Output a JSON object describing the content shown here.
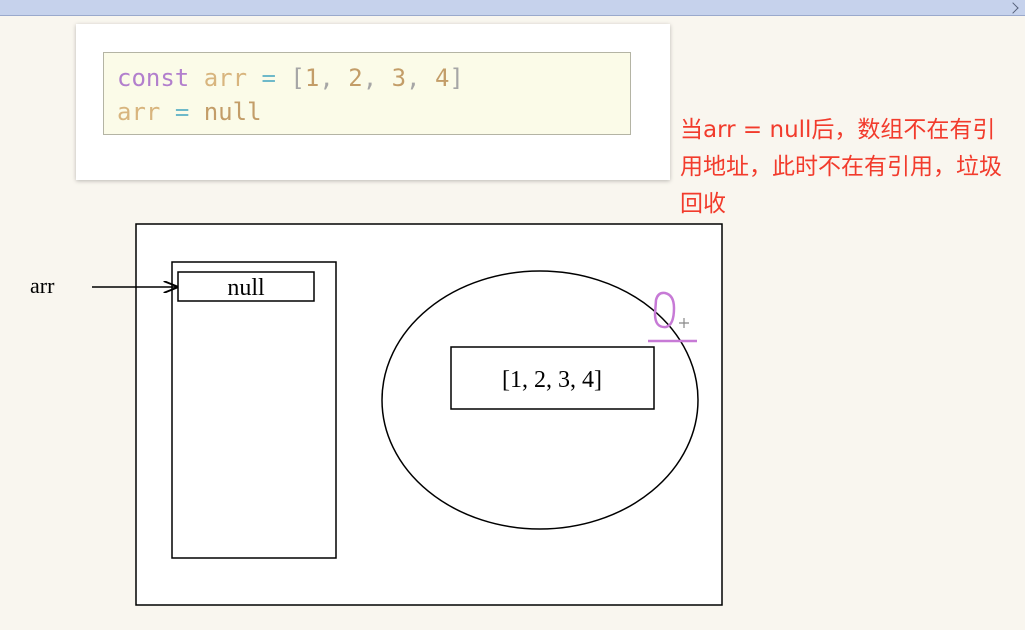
{
  "code": {
    "line1": {
      "keyword": "const",
      "name": "arr",
      "op": "=",
      "open": "[",
      "n1": "1",
      "c1": ",",
      "n2": "2",
      "c2": ",",
      "n3": "3",
      "c3": ",",
      "n4": "4",
      "close": "]"
    },
    "line2": {
      "name": "arr",
      "op": "=",
      "value": "null"
    }
  },
  "note": {
    "text": "当arr = null后，数组不在有引用地址，此时不在有引用，垃圾回收"
  },
  "diagram": {
    "pointer_label": "arr",
    "stack_cell": "null",
    "heap_value": "[1, 2, 3, 4]"
  },
  "colors": {
    "note": "#f23b2c",
    "annotation_pen": "#c77ad6"
  }
}
